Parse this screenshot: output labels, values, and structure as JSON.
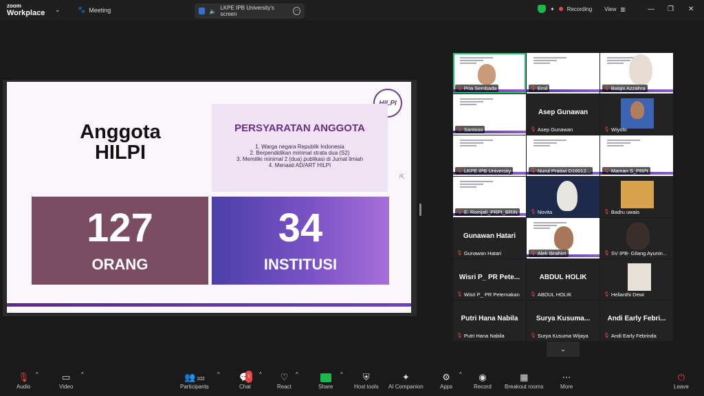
{
  "app": {
    "brand_top": "zoom",
    "brand_bottom": "Workplace",
    "meeting_label": "Meeting",
    "screen_title": "LKPE IPB University's screen",
    "recording": "Recording",
    "view": "View"
  },
  "slide": {
    "title": "Anggota HILPI",
    "logo_text": "HILPI",
    "req_heading": "PERSYARATAN ANGGOTA",
    "req_items": [
      "1. Warga negara Republik Indonesia",
      "2. Berpendidikan minimal strata dua (S2)",
      "3. Memiliki minimal 2 (dua) publikasi di Jurnal ilmiah",
      "4. Menaati AD/ART HILPI"
    ],
    "stat1_value": "127",
    "stat1_label": "ORANG",
    "stat2_value": "34",
    "stat2_label": "INSTITUSI"
  },
  "participants": [
    {
      "name": "Pria Sembada"
    },
    {
      "name": "Emil"
    },
    {
      "name": "Balqis Azzahra"
    },
    {
      "name": "Santoso"
    },
    {
      "name": "Asep Gunawan",
      "big": "Asep Gunawan"
    },
    {
      "name": "Wiyoto"
    },
    {
      "name": "LKPE IPB University"
    },
    {
      "name": "Nurul Pratiwi D16012..."
    },
    {
      "name": "Maman S_PRPt"
    },
    {
      "name": "E. Romjali_PRPt_BRIN"
    },
    {
      "name": "Novita"
    },
    {
      "name": "Badru uwais"
    },
    {
      "name": "Gunawan Hatari",
      "big": "Gunawan Hatari"
    },
    {
      "name": "Alek Ibrahim"
    },
    {
      "name": "SV IPB- Gilang Ayunin..."
    },
    {
      "name": "Wisri P_ PR Peternakan",
      "big": "Wisri P_ PR Pete..."
    },
    {
      "name": "ABDUL HOLIK",
      "big": "ABDUL HOLIK"
    },
    {
      "name": "Helianthi Dewi"
    },
    {
      "name": "Putri Hana Nabila",
      "big": "Putri Hana Nabila"
    },
    {
      "name": "Surya Kusuma Wijaya",
      "big": "Surya Kusuma..."
    },
    {
      "name": "Andi Early Febrinda",
      "big": "Andi Early Febri..."
    }
  ],
  "toolbar": {
    "audio": "Audio",
    "video": "Video",
    "participants": "Participants",
    "participants_count": "102",
    "chat": "Chat",
    "chat_badge": "1",
    "react": "React",
    "share": "Share",
    "host_tools": "Host tools",
    "ai_companion": "AI Companion",
    "apps": "Apps",
    "record": "Record",
    "breakout": "Breakout rooms",
    "more": "More",
    "leave": "Leave"
  },
  "colors": {
    "accent_green": "#1bb84b",
    "recording_red": "#e84545",
    "slide_purple": "#6a2d8a"
  }
}
